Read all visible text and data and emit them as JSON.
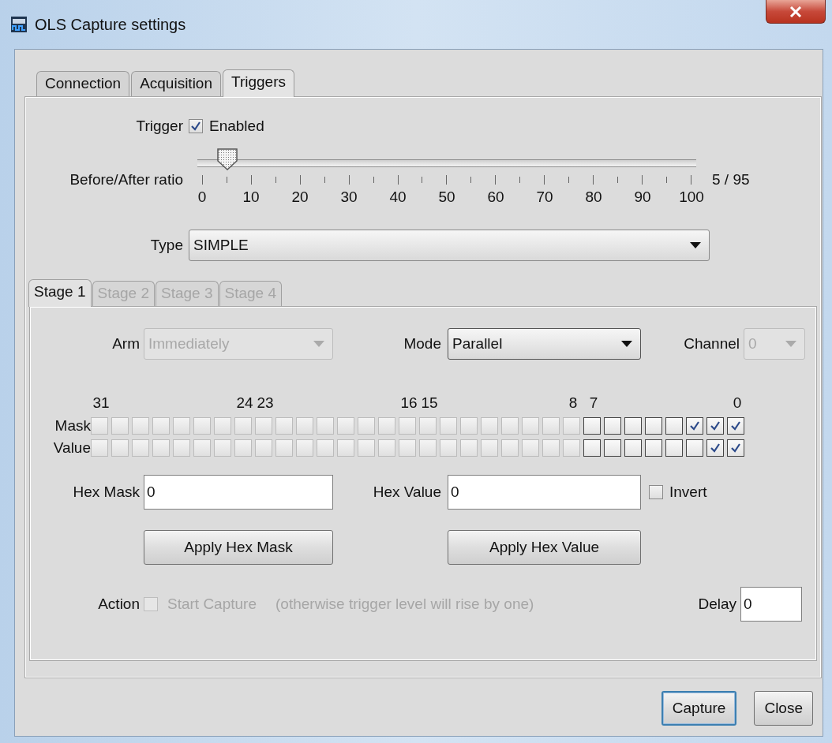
{
  "window": {
    "title": "OLS Capture settings"
  },
  "tabs": [
    {
      "label": "Connection",
      "selected": false
    },
    {
      "label": "Acquisition",
      "selected": false
    },
    {
      "label": "Triggers",
      "selected": true
    }
  ],
  "trigger": {
    "label": "Trigger",
    "enabled": {
      "label": "Enabled",
      "checked": true
    }
  },
  "ratio": {
    "label": "Before/After ratio",
    "level": 0.05,
    "reading": "5 / 95",
    "tick_labels": [
      "0",
      "10",
      "20",
      "30",
      "40",
      "50",
      "60",
      "70",
      "80",
      "90",
      "100"
    ]
  },
  "type": {
    "label": "Type",
    "value": "SIMPLE"
  },
  "stage_tabs": [
    {
      "label": "Stage 1",
      "selected": true,
      "disabled": false
    },
    {
      "label": "Stage 2",
      "selected": false,
      "disabled": true
    },
    {
      "label": "Stage 3",
      "selected": false,
      "disabled": true
    },
    {
      "label": "Stage 4",
      "selected": false,
      "disabled": true
    }
  ],
  "selectors": [
    {
      "label": "Arm",
      "value": "Immediately",
      "disabled": true
    },
    {
      "label": "Mode",
      "value": "Parallel",
      "disabled": false
    },
    {
      "label": "Channel",
      "value": "0",
      "disabled": true
    }
  ],
  "bit_labels": [
    "31",
    "24",
    "23",
    "16",
    "15",
    "8",
    "7",
    "0"
  ],
  "bit_rows": [
    {
      "label": "Mask",
      "bits": [
        {
          "checked": false,
          "disabled": true
        },
        {
          "checked": false,
          "disabled": true
        },
        {
          "checked": false,
          "disabled": true
        },
        {
          "checked": false,
          "disabled": true
        },
        {
          "checked": false,
          "disabled": true
        },
        {
          "checked": false,
          "disabled": true
        },
        {
          "checked": false,
          "disabled": true
        },
        {
          "checked": false,
          "disabled": true
        },
        {
          "checked": false,
          "disabled": true
        },
        {
          "checked": false,
          "disabled": true
        },
        {
          "checked": false,
          "disabled": true
        },
        {
          "checked": false,
          "disabled": true
        },
        {
          "checked": false,
          "disabled": true
        },
        {
          "checked": false,
          "disabled": true
        },
        {
          "checked": false,
          "disabled": true
        },
        {
          "checked": false,
          "disabled": true
        },
        {
          "checked": false,
          "disabled": true
        },
        {
          "checked": false,
          "disabled": true
        },
        {
          "checked": false,
          "disabled": true
        },
        {
          "checked": false,
          "disabled": true
        },
        {
          "checked": false,
          "disabled": true
        },
        {
          "checked": false,
          "disabled": true
        },
        {
          "checked": false,
          "disabled": true
        },
        {
          "checked": false,
          "disabled": true
        },
        {
          "checked": false,
          "disabled": false
        },
        {
          "checked": false,
          "disabled": false
        },
        {
          "checked": false,
          "disabled": false
        },
        {
          "checked": false,
          "disabled": false
        },
        {
          "checked": false,
          "disabled": false
        },
        {
          "checked": true,
          "disabled": false
        },
        {
          "checked": true,
          "disabled": false
        },
        {
          "checked": true,
          "disabled": false
        }
      ]
    },
    {
      "label": "Value",
      "bits": [
        {
          "checked": false,
          "disabled": true
        },
        {
          "checked": false,
          "disabled": true
        },
        {
          "checked": false,
          "disabled": true
        },
        {
          "checked": false,
          "disabled": true
        },
        {
          "checked": false,
          "disabled": true
        },
        {
          "checked": false,
          "disabled": true
        },
        {
          "checked": false,
          "disabled": true
        },
        {
          "checked": false,
          "disabled": true
        },
        {
          "checked": false,
          "disabled": true
        },
        {
          "checked": false,
          "disabled": true
        },
        {
          "checked": false,
          "disabled": true
        },
        {
          "checked": false,
          "disabled": true
        },
        {
          "checked": false,
          "disabled": true
        },
        {
          "checked": false,
          "disabled": true
        },
        {
          "checked": false,
          "disabled": true
        },
        {
          "checked": false,
          "disabled": true
        },
        {
          "checked": false,
          "disabled": true
        },
        {
          "checked": false,
          "disabled": true
        },
        {
          "checked": false,
          "disabled": true
        },
        {
          "checked": false,
          "disabled": true
        },
        {
          "checked": false,
          "disabled": true
        },
        {
          "checked": false,
          "disabled": true
        },
        {
          "checked": false,
          "disabled": true
        },
        {
          "checked": false,
          "disabled": true
        },
        {
          "checked": false,
          "disabled": false
        },
        {
          "checked": false,
          "disabled": false
        },
        {
          "checked": false,
          "disabled": false
        },
        {
          "checked": false,
          "disabled": false
        },
        {
          "checked": false,
          "disabled": false
        },
        {
          "checked": false,
          "disabled": false
        },
        {
          "checked": true,
          "disabled": false
        },
        {
          "checked": true,
          "disabled": false
        }
      ]
    }
  ],
  "hex_mask": {
    "label": "Hex Mask",
    "value": "0"
  },
  "hex_value": {
    "label": "Hex Value",
    "value": "0"
  },
  "invert": {
    "label": "Invert",
    "checked": false
  },
  "apply_buttons": [
    "Apply Hex Mask",
    "Apply Hex Value"
  ],
  "action": {
    "label": "Action",
    "option": {
      "label": "Start Capture",
      "checked": false,
      "disabled": true
    },
    "note": "(otherwise trigger level will rise by one)"
  },
  "delay": {
    "label": "Delay",
    "value": "0"
  },
  "buttons": [
    {
      "label": "Capture",
      "default": true
    },
    {
      "label": "Close",
      "default": false
    }
  ]
}
